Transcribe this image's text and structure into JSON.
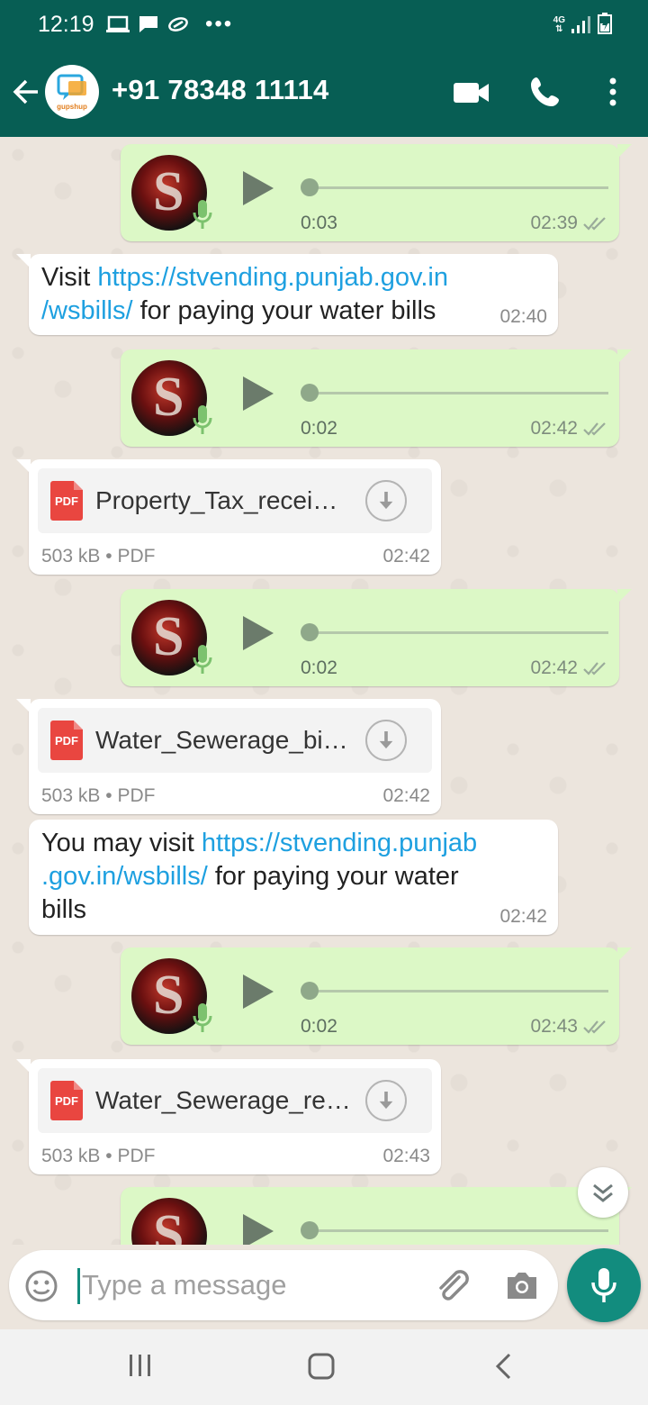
{
  "status_bar": {
    "time": "12:19",
    "overflow": "•••",
    "network": "4G",
    "icons": [
      "laptop-icon",
      "message-icon",
      "link-icon",
      "signal-icon",
      "battery-icon"
    ]
  },
  "app_bar": {
    "contact": "+91 78348 11114",
    "avatar_brand": "gupshup",
    "avatar_code": "</>",
    "icons": [
      "back-arrow-icon",
      "video-call-icon",
      "phone-icon",
      "more-vert-icon"
    ]
  },
  "messages": [
    {
      "type": "voice",
      "direction": "outgoing",
      "duration": "0:03",
      "time": "02:39",
      "status": "read"
    },
    {
      "type": "text",
      "direction": "incoming",
      "prefix": "Visit ",
      "link": "https://stvending.punjab.gov.in/wsbills/",
      "link_line1": "https://stvending.punjab.gov.in",
      "link_line2": "/wsbills/",
      "suffix": " for paying your water bills",
      "time": "02:40"
    },
    {
      "type": "voice",
      "direction": "outgoing",
      "duration": "0:02",
      "time": "02:42",
      "status": "read"
    },
    {
      "type": "document",
      "direction": "incoming",
      "filename": "Property_Tax_recei…",
      "size": "503 kB",
      "sep": "•",
      "filetype": "PDF",
      "icon_label": "PDF",
      "time": "02:42"
    },
    {
      "type": "voice",
      "direction": "outgoing",
      "duration": "0:02",
      "time": "02:42",
      "status": "read"
    },
    {
      "type": "document",
      "direction": "incoming",
      "filename": "Water_Sewerage_bi…",
      "size": "503 kB",
      "sep": "•",
      "filetype": "PDF",
      "icon_label": "PDF",
      "time": "02:42"
    },
    {
      "type": "text",
      "direction": "incoming",
      "prefix": "You may visit ",
      "link": "https://stvending.punjab.gov.in/wsbills/",
      "link_line1": "https://stvending.punjab",
      "link_line2": ".gov.in/wsbills/",
      "suffix": " for paying your water",
      "suffix2": "bills",
      "time": "02:42"
    },
    {
      "type": "voice",
      "direction": "outgoing",
      "duration": "0:02",
      "time": "02:43",
      "status": "read"
    },
    {
      "type": "document",
      "direction": "incoming",
      "filename": "Water_Sewerage_re…",
      "size": "503 kB",
      "sep": "•",
      "filetype": "PDF",
      "icon_label": "PDF",
      "time": "02:43"
    },
    {
      "type": "voice",
      "direction": "outgoing",
      "duration": "",
      "time": "",
      "status": "partial"
    }
  ],
  "input": {
    "placeholder": "Type a message",
    "icons": [
      "emoji-icon",
      "attach-icon",
      "camera-icon",
      "mic-icon"
    ]
  },
  "colors": {
    "header": "#075e54",
    "outgoing_bubble": "#dcf8c6",
    "incoming_bubble": "#ffffff",
    "link": "#1ea0e0",
    "accent": "#128c7e"
  }
}
